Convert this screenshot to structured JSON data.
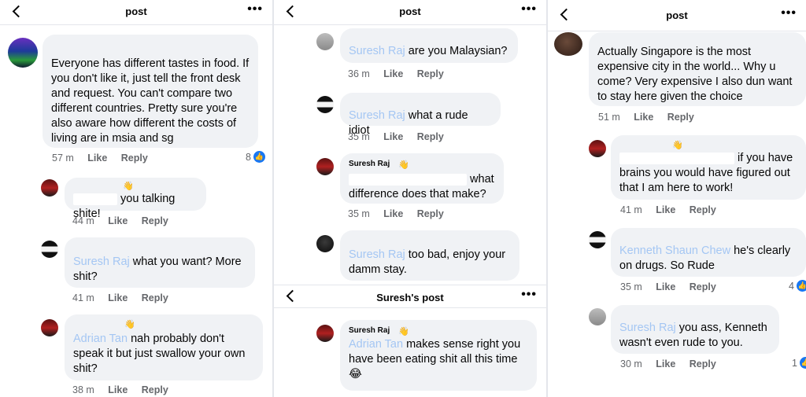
{
  "panels": [
    {
      "header": {
        "title": "post",
        "more": "•••"
      },
      "comments": [
        {
          "text": "Everyone has different tastes in food. If you don't like it,  just tell the front desk and request. You can't compare two different countries.  Pretty sure you're also aware how different the costs of living are in msia and sg",
          "time": "57 m",
          "like": "Like",
          "reply": "Reply",
          "reactions": "8"
        },
        {
          "text": "you talking shite!",
          "time": "44 m",
          "like": "Like",
          "reply": "Reply"
        },
        {
          "mention": "Suresh Raj",
          "text": "what you want? More shit?",
          "time": "41 m",
          "like": "Like",
          "reply": "Reply"
        },
        {
          "mention": "Adrian Tan",
          "text": "nah probably don't speak it but just swallow your own shit?",
          "time": "38 m",
          "like": "Like",
          "reply": "Reply"
        }
      ]
    },
    {
      "header": {
        "title": "post",
        "more": "•••"
      },
      "comments": [
        {
          "mention": "Suresh Raj",
          "text": "are you Malaysian?",
          "time": "36 m",
          "like": "Like",
          "reply": "Reply"
        },
        {
          "mention": "Suresh Raj",
          "text": "what a rude idiot",
          "time": "35 m",
          "like": "Like",
          "reply": "Reply"
        },
        {
          "name": "Suresh Raj",
          "text": "what difference does that make?",
          "time": "35 m",
          "like": "Like",
          "reply": "Reply"
        },
        {
          "mention": "Suresh Raj",
          "text": "too bad, enjoy your damm stay.",
          "time": "",
          "like": "",
          "reply": ""
        },
        {
          "name": "Suresh Raj",
          "mention": "Adrian Tan",
          "text": "makes sense right you have been eating shit all this time",
          "emoji": "😂"
        }
      ],
      "header2": {
        "title": "Suresh's post",
        "more": "•••"
      }
    },
    {
      "header": {
        "title": "post",
        "more": "•••"
      },
      "comments": [
        {
          "text": "Actually Singapore is the most expensive city in the world... Why u come? Very expensive I also dun want to stay here given the choice",
          "time": "51 m",
          "like": "Like",
          "reply": "Reply"
        },
        {
          "text": "if you have brains you would have figured out that I am here to work!",
          "time": "41 m",
          "like": "Like",
          "reply": "Reply"
        },
        {
          "mention": "Kenneth Shaun Chew",
          "text": "he's clearly on drugs. So Rude",
          "time": "35 m",
          "like": "Like",
          "reply": "Reply",
          "reactions": "4"
        },
        {
          "mention": "Suresh Raj",
          "text": "you ass, Kenneth wasn't even rude to you.",
          "time": "30 m",
          "like": "Like",
          "reply": "Reply",
          "reactions": "1"
        }
      ]
    }
  ]
}
